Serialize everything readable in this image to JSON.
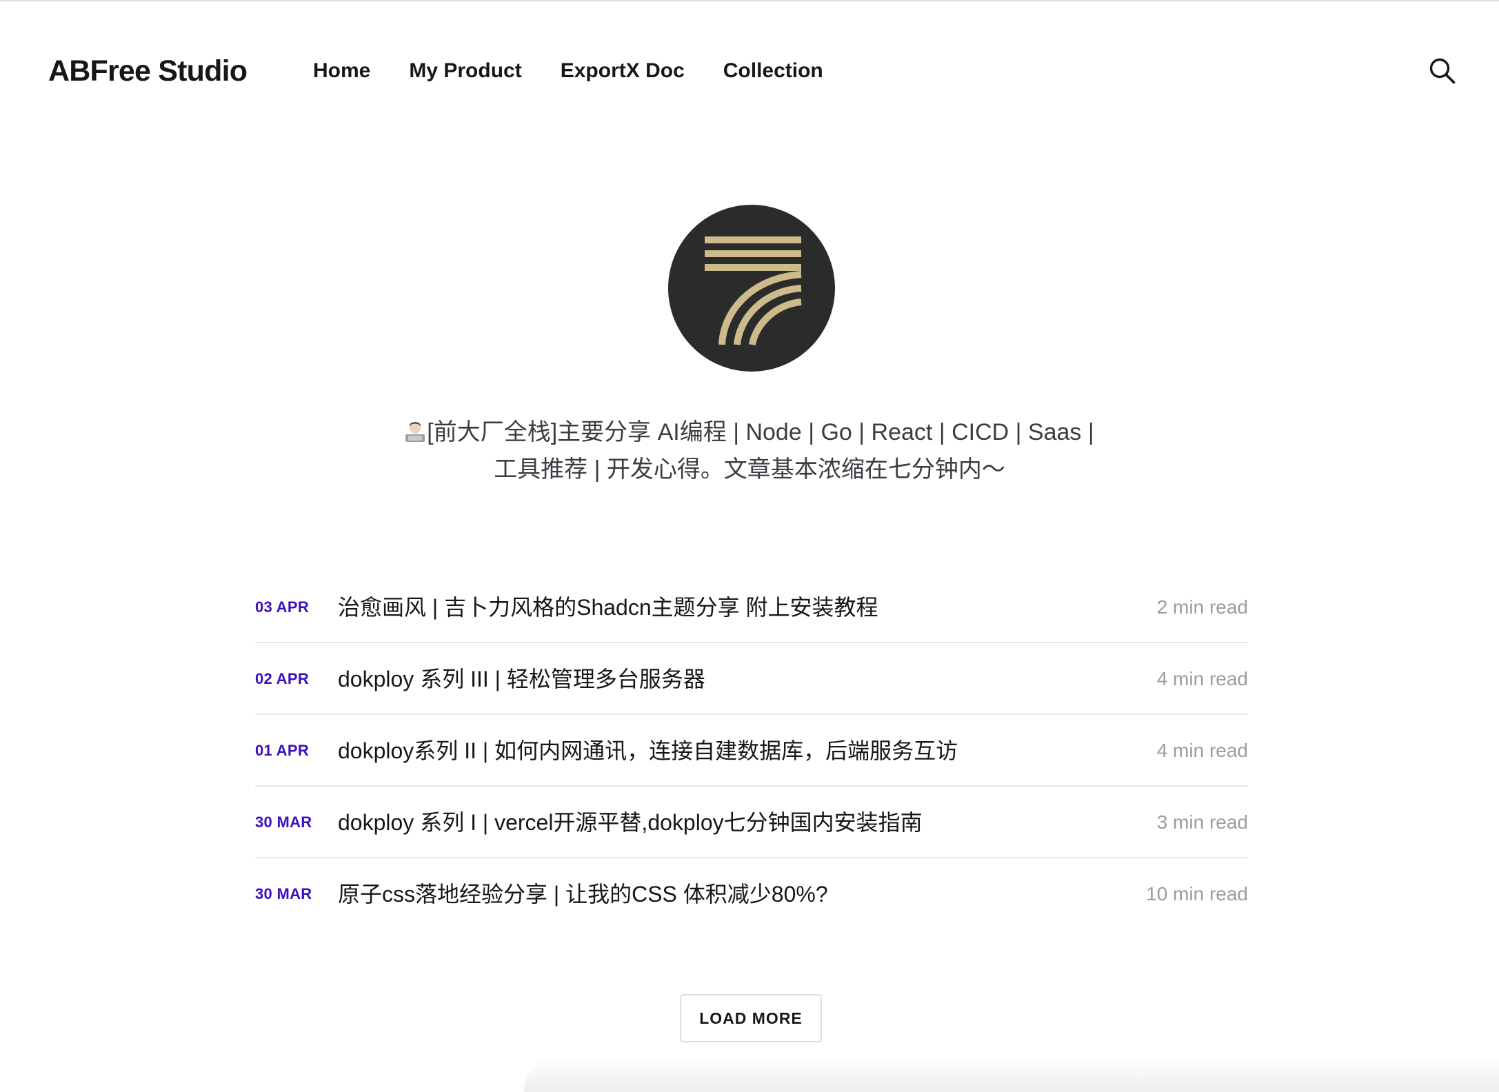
{
  "site": {
    "title": "ABFree Studio"
  },
  "nav": {
    "items": [
      {
        "label": "Home"
      },
      {
        "label": "My Product"
      },
      {
        "label": "ExportX Doc"
      },
      {
        "label": "Collection"
      }
    ]
  },
  "header": {
    "search_icon": "search-icon"
  },
  "hero": {
    "avatar_icon": "studio-logo",
    "bio_line1": "[前大厂全栈]主要分享 AI编程 | Node | Go | React | CICD | Saas |",
    "bio_line2": "工具推荐 | 开发心得。文章基本浓缩在七分钟内～",
    "bio_emoji": "technologist-emoji"
  },
  "posts": [
    {
      "date": "03 APR",
      "title": "治愈画风 | 吉卜力风格的Shadcn主题分享 附上安装教程",
      "read": "2 min read"
    },
    {
      "date": "02 APR",
      "title": "dokploy 系列 III | 轻松管理多台服务器",
      "read": "4 min read"
    },
    {
      "date": "01 APR",
      "title": "dokploy系列 II | 如何内网通讯，连接自建数据库，后端服务互访",
      "read": "4 min read"
    },
    {
      "date": "30 MAR",
      "title": "dokploy 系列 I | vercel开源平替,dokploy七分钟国内安装指南",
      "read": "3 min read"
    },
    {
      "date": "30 MAR",
      "title": "原子css落地经验分享 | 让我的CSS 体积减少80%?",
      "read": "10 min read"
    }
  ],
  "load_more": {
    "label": "LOAD MORE"
  },
  "colors": {
    "accent": "#3c0fbd",
    "text": "#15171a",
    "muted": "#9a9ca1",
    "logo_gold": "#cdbb8c",
    "avatar_bg": "#2b2b2b"
  }
}
